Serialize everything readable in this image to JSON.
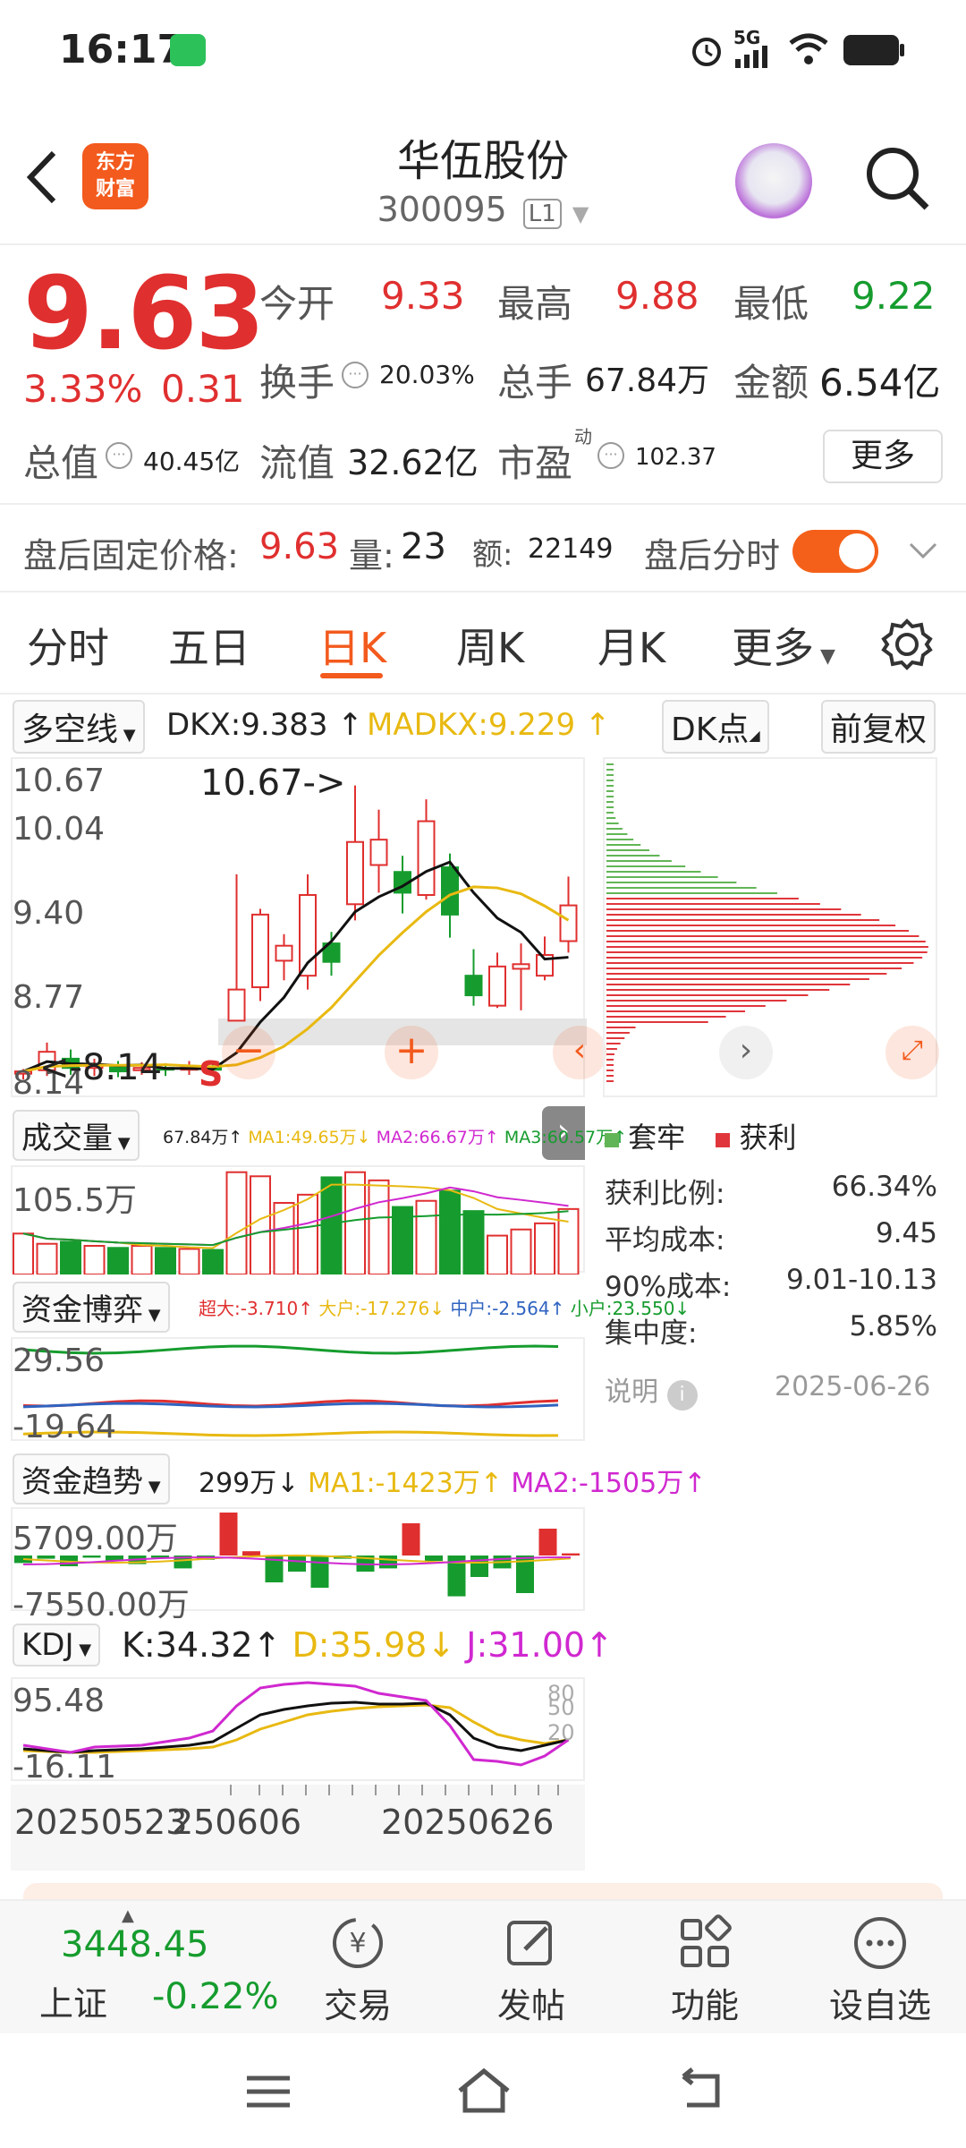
{
  "status_bar": {
    "time": "16:17",
    "network": "5G"
  },
  "header": {
    "back": "<",
    "logo_line1": "东方",
    "logo_line2": "财富",
    "title": "华伍股份",
    "code": "300095",
    "level": "L1"
  },
  "quote": {
    "price": "9.63",
    "change_pct": "3.33%",
    "change": "0.31",
    "open_label": "今开",
    "open": "9.33",
    "high_label": "最高",
    "high": "9.88",
    "low_label": "最低",
    "low": "9.22",
    "turnover_label": "换手",
    "turnover": "20.03%",
    "volume_label": "总手",
    "volume": "67.84万",
    "amount_label": "金额",
    "amount": "6.54亿",
    "mktcap_label": "总值",
    "mktcap": "40.45亿",
    "float_label": "流值",
    "float": "32.62亿",
    "pe_label": "市盈",
    "pe_sup": "动",
    "pe": "102.37",
    "more": "更多"
  },
  "after_hours": {
    "price_label": "盘后固定价格:",
    "price": "9.63",
    "vol_label": "量:",
    "vol": "23",
    "amt_label": "额:",
    "amt": "22149",
    "toggle_label": "盘后分时"
  },
  "tabs": [
    "分时",
    "五日",
    "日K",
    "周K",
    "月K",
    "更多"
  ],
  "chart": {
    "indicator": "多空线",
    "dkx": "DKX:9.383 ↑",
    "madkx": "MADKX:9.229 ↑",
    "dk_point": "DK点",
    "adjust": "前复权",
    "y_labels": [
      "10.67",
      "10.04",
      "9.40",
      "8.77",
      "8.14"
    ],
    "high_marker": "10.67->",
    "low_marker": "<-8.14",
    "s_marker": "S",
    "x_labels": [
      "20250523",
      "250606",
      "20250626"
    ],
    "candles": [
      {
        "o": 8.17,
        "c": 8.19,
        "h": 8.21,
        "l": 8.12
      },
      {
        "o": 8.2,
        "c": 8.36,
        "h": 8.44,
        "l": 8.15
      },
      {
        "o": 8.3,
        "c": 8.22,
        "h": 8.38,
        "l": 8.16
      },
      {
        "o": 8.22,
        "c": 8.24,
        "h": 8.3,
        "l": 8.15
      },
      {
        "o": 8.23,
        "c": 8.19,
        "h": 8.28,
        "l": 8.14
      },
      {
        "o": 8.2,
        "c": 8.22,
        "h": 8.27,
        "l": 8.16
      },
      {
        "o": 8.22,
        "c": 8.21,
        "h": 8.26,
        "l": 8.15
      },
      {
        "o": 8.21,
        "c": 8.22,
        "h": 8.28,
        "l": 8.16
      },
      {
        "o": 8.22,
        "c": 8.21,
        "h": 8.27,
        "l": 8.17
      },
      {
        "o": 8.63,
        "c": 8.9,
        "h": 9.9,
        "l": 8.63
      },
      {
        "o": 8.92,
        "c": 9.55,
        "h": 9.6,
        "l": 8.8
      },
      {
        "o": 9.15,
        "c": 9.28,
        "h": 9.38,
        "l": 8.98
      },
      {
        "o": 9.02,
        "c": 9.72,
        "h": 9.9,
        "l": 8.9
      },
      {
        "o": 9.3,
        "c": 9.14,
        "h": 9.4,
        "l": 9.02
      },
      {
        "o": 9.64,
        "c": 10.18,
        "h": 10.67,
        "l": 9.5
      },
      {
        "o": 9.98,
        "c": 10.2,
        "h": 10.46,
        "l": 9.74
      },
      {
        "o": 9.92,
        "c": 9.74,
        "h": 10.06,
        "l": 9.56
      },
      {
        "o": 9.72,
        "c": 10.36,
        "h": 10.55,
        "l": 9.68
      },
      {
        "o": 9.96,
        "c": 9.55,
        "h": 10.08,
        "l": 9.35
      },
      {
        "o": 9.02,
        "c": 8.85,
        "h": 9.25,
        "l": 8.76
      },
      {
        "o": 8.76,
        "c": 9.1,
        "h": 9.22,
        "l": 8.74
      },
      {
        "o": 9.08,
        "c": 9.12,
        "h": 9.3,
        "l": 8.72
      },
      {
        "o": 9.02,
        "c": 9.2,
        "h": 9.36,
        "l": 8.98
      },
      {
        "o": 9.32,
        "c": 9.63,
        "h": 9.88,
        "l": 9.22
      }
    ],
    "chip_dist": {
      "legend_trapped": "套牢",
      "legend_profit": "获利"
    },
    "cost": [
      {
        "label": "获利比例:",
        "value": "66.34%"
      },
      {
        "label": "平均成本:",
        "value": "9.45"
      },
      {
        "label": "90%成本:",
        "value": "9.01-10.13"
      },
      {
        "label": "集中度:",
        "value": "5.85%"
      }
    ],
    "cost_note": "说明",
    "cost_date": "2025-06-26"
  },
  "volume_panel": {
    "name": "成交量",
    "vol": "67.84万↑",
    "ma1": "MA1:49.65万↓",
    "ma2": "MA2:66.67万↑",
    "ma3": "MA3:60.57万↑",
    "y_label": "105.5万",
    "values": [
      40,
      30,
      32,
      28,
      26,
      28,
      26,
      25,
      24,
      100,
      96,
      70,
      78,
      95,
      100,
      92,
      66,
      72,
      82,
      62,
      38,
      44,
      50,
      64
    ]
  },
  "fund_panel": {
    "name": "资金博弈",
    "super": "超大:-3.710↑",
    "large": "大户:-17.276↓",
    "mid": "中户:-2.564↑",
    "small": "小户:23.550↓",
    "y_top": "29.56",
    "y_bot": "-19.64"
  },
  "trend_panel": {
    "name": "资金趋势",
    "val": "299万↓",
    "ma1": "MA1:-1423万↑",
    "ma2": "MA2:-1505万↑",
    "y_top": "5709.00万",
    "y_bot": "-7550.00万",
    "values": [
      -7,
      -3,
      -10,
      -2,
      -5,
      -8,
      -2,
      -12,
      -4,
      40,
      4,
      -25,
      -15,
      -30,
      -3,
      -15,
      -12,
      30,
      -5,
      -38,
      -20,
      -12,
      -35,
      25,
      2
    ]
  },
  "kdj_panel": {
    "name": "KDJ",
    "k": "K:34.32↑",
    "d": "D:35.98↓",
    "j": "J:31.00↑",
    "y_top": "95.48",
    "y_bot": "-16.11",
    "right_labels": [
      "80",
      "50",
      "20"
    ]
  },
  "bottom_bar": {
    "index_value": "3448.45",
    "index_name": "上证",
    "index_change": "-0.22%",
    "trade": "交易",
    "post": "发帖",
    "func": "功能",
    "watch": "设自选"
  },
  "colors": {
    "up": "#e02f2f",
    "down": "#169c2e",
    "accent": "#f35a1d"
  }
}
